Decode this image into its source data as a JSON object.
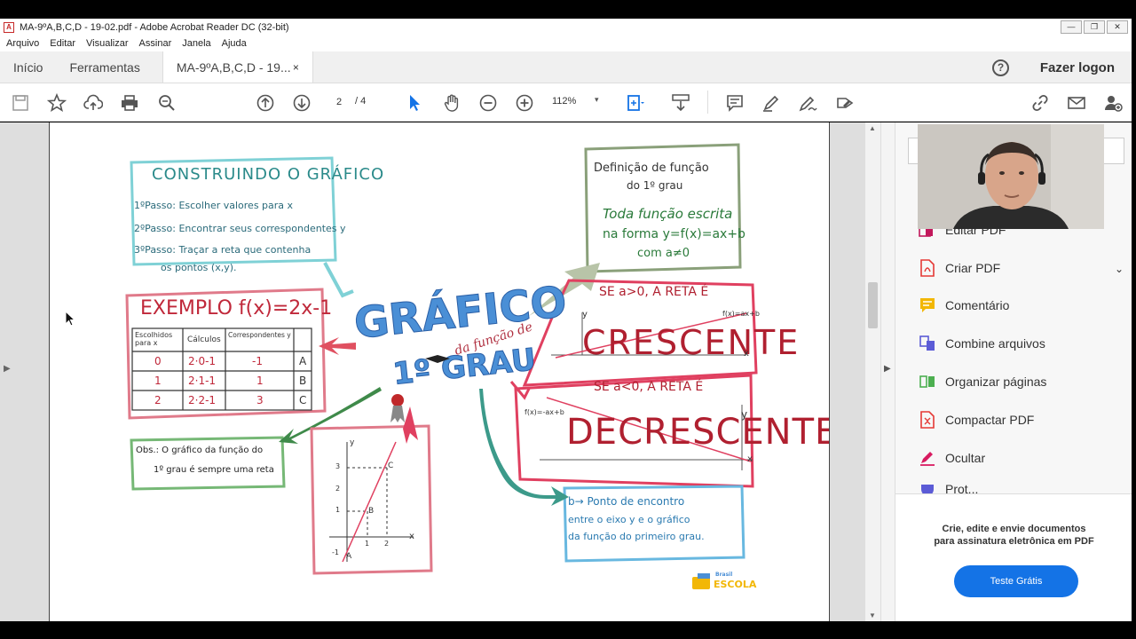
{
  "window": {
    "title": "MA-9ºA,B,C,D - 19-02.pdf - Adobe Acrobat Reader DC (32-bit)",
    "buttons": [
      "—",
      "❐",
      "✕"
    ]
  },
  "menu": [
    "Arquivo",
    "Editar",
    "Visualizar",
    "Assinar",
    "Janela",
    "Ajuda"
  ],
  "tabs": {
    "home": "Início",
    "tools": "Ferramentas",
    "document": "MA-9ºA,B,C,D - 19...",
    "close": "×",
    "help": "?",
    "login": "Fazer logon"
  },
  "toolbar": {
    "page_current": "2",
    "page_total": "/ 4",
    "zoom": "112%",
    "zoom_arrow": "▾"
  },
  "mindmap": {
    "center_title_1": "GRÁFICO",
    "center_title_2": "1º GRAU",
    "center_subtitle": "da função de",
    "construct": {
      "title": "CONSTRUINDO O GRÁFICO",
      "step1": "1ºPasso: Escolher valores para x",
      "step2": "2ºPasso: Encontrar seus correspondentes y",
      "step3": "3ºPasso: Traçar a reta que contenha",
      "step3b": "os pontos (x,y)."
    },
    "definition": {
      "title_1": "Definição de função",
      "title_2": "do 1º grau",
      "text_1": "Toda função escrita",
      "text_2": "na forma y=f(x)=ax+b",
      "text_3": "com a≠0"
    },
    "example": {
      "title": "EXEMPLO  f(x)=2x-1",
      "headers": [
        "Escolhidos para x",
        "Cálculos",
        "Correspondentes y",
        ""
      ],
      "rows": [
        [
          "0",
          "2·0-1",
          "-1",
          "A"
        ],
        [
          "1",
          "2·1-1",
          "1",
          "B"
        ],
        [
          "2",
          "2·2-1",
          "3",
          "C"
        ]
      ]
    },
    "crescente": {
      "cond": "SE a>0, A RETA É",
      "word": "CRESCENTE",
      "fx": "f(x)=ax+b",
      "y": "y",
      "x": "x"
    },
    "decrescente": {
      "cond": "SE a<0, A RETA É",
      "word": "DECRESCENTE",
      "fx": "f(x)=-ax+b",
      "y": "y",
      "x": "x"
    },
    "obs": {
      "line1": "Obs.: O gráfico da função do",
      "line2": "1º grau é sempre uma reta"
    },
    "b_point": {
      "line1": "b→ Ponto de encontro",
      "line2": "entre o eixo y e o gráfico",
      "line3": "da função do primeiro grau."
    },
    "graph": {
      "y_label": "y",
      "x_label": "x",
      "ticks_y": [
        "3",
        "2",
        "1",
        "-1"
      ],
      "ticks_x": [
        "1",
        "2"
      ],
      "points": [
        "A",
        "B",
        "C"
      ]
    },
    "logo_small": "Brasil",
    "logo": "ESCOLA"
  },
  "rightpane": {
    "tools": [
      {
        "label": "Editar PDF",
        "icon": "edit-pdf-icon",
        "color": "#c2185b"
      },
      {
        "label": "Criar PDF",
        "icon": "create-pdf-icon",
        "color": "#e53935"
      },
      {
        "label": "Comentário",
        "icon": "comment-icon",
        "color": "#f2b705"
      },
      {
        "label": "Combine arquivos",
        "icon": "combine-files-icon",
        "color": "#5b5bd6"
      },
      {
        "label": "Organizar páginas",
        "icon": "organize-pages-icon",
        "color": "#4caf50"
      },
      {
        "label": "Compactar PDF",
        "icon": "compress-pdf-icon",
        "color": "#e53935"
      },
      {
        "label": "Ocultar",
        "icon": "redact-icon",
        "color": "#d81b60"
      },
      {
        "label": "Prot...",
        "icon": "protect-icon",
        "color": "#5b5bd6"
      }
    ],
    "expand": "⌄",
    "promo_line1": "Crie, edite e envie documentos",
    "promo_line2": "para assinatura eletrônica em PDF",
    "promo_button": "Teste Grátis"
  }
}
